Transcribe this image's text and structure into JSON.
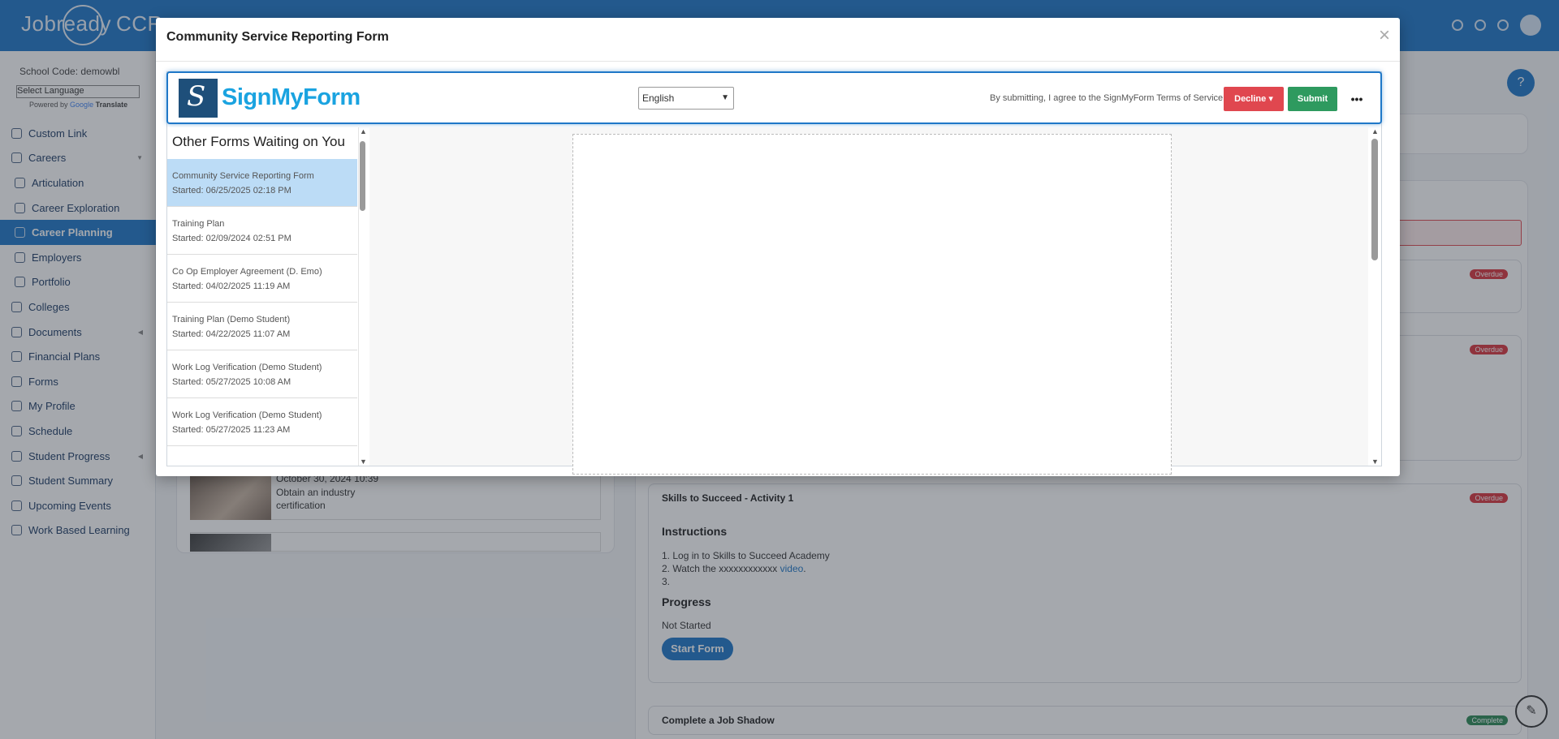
{
  "app": {
    "brand": "Jobready",
    "brand_suffix": "CCR"
  },
  "sidebar": {
    "school_code": "School Code: demowbl",
    "language_select": "Select Language",
    "powered_by": "Powered by",
    "translate": "Translate",
    "items": [
      {
        "label": "Custom Link",
        "icon": "link-icon"
      },
      {
        "label": "Careers",
        "icon": "person-icon",
        "caret": "▼"
      },
      {
        "label": "Articulation",
        "icon": "forward-icon"
      },
      {
        "label": "Career Exploration",
        "icon": "rocket-icon"
      },
      {
        "label": "Career Planning",
        "icon": "network-icon"
      },
      {
        "label": "Employers",
        "icon": "person-icon"
      },
      {
        "label": "Portfolio",
        "icon": "briefcase-icon"
      },
      {
        "label": "Colleges",
        "icon": "graduation-cap-icon"
      },
      {
        "label": "Documents",
        "icon": "document-icon",
        "caret": "◀"
      },
      {
        "label": "Financial Plans",
        "icon": "piggy-bank-icon"
      },
      {
        "label": "Forms",
        "icon": "form-icon"
      },
      {
        "label": "My Profile",
        "icon": "person-icon"
      },
      {
        "label": "Schedule",
        "icon": "clock-icon"
      },
      {
        "label": "Student Progress",
        "icon": "list-icon",
        "caret": "◀"
      },
      {
        "label": "Student Summary",
        "icon": "list-icon"
      },
      {
        "label": "Upcoming Events",
        "icon": "bell-icon"
      },
      {
        "label": "Work Based Learning",
        "icon": "person-icon"
      }
    ]
  },
  "feed": {
    "date": "October 30, 2024 10:39",
    "text": "Obtain an industry certification"
  },
  "tasks": {
    "badge_overdue": "Overdue",
    "badge_complete": "Complete",
    "skills": {
      "title": "Skills to Succeed - Activity 1",
      "instructions_heading": "Instructions",
      "step1": "Log in to Skills to Succeed Academy",
      "step2_prefix": "Watch the xxxxxxxxxxxx",
      "step2_link": "video",
      "step2_suffix": ".",
      "progress_heading": "Progress",
      "progress_value": "Not Started",
      "start_button": "Start Form"
    },
    "job_shadow": {
      "title": "Complete a Job Shadow"
    }
  },
  "modal": {
    "title": "Community Service Reporting Form",
    "close": "×"
  },
  "signmyform": {
    "logo_text": "SignMyForm",
    "language": "English",
    "terms": "By submitting, I agree to the SignMyForm Terms of Service.",
    "decline": "Decline",
    "decline_caret": "▾",
    "submit": "Submit",
    "more": "•••",
    "list_heading": "Other Forms Waiting on You",
    "forms": [
      {
        "name": "Community Service Reporting Form",
        "started": "Started: 06/25/2025 02:18 PM"
      },
      {
        "name": "Training Plan",
        "started": "Started: 02/09/2024 02:51 PM"
      },
      {
        "name": "Co Op Employer Agreement (D. Emo)",
        "started": "Started: 04/02/2025 11:19 AM"
      },
      {
        "name": "Training Plan (Demo Student)",
        "started": "Started: 04/22/2025 11:07 AM"
      },
      {
        "name": "Work Log Verification (Demo Student)",
        "started": "Started: 05/27/2025 10:08 AM"
      },
      {
        "name": "Work Log Verification (Demo Student)",
        "started": "Started: 05/27/2025 11:23 AM"
      }
    ]
  },
  "colors": {
    "primary": "#1f78c8",
    "danger": "#e0474f",
    "success": "#2e9a5f",
    "selected_row": "#bcdcf6"
  }
}
